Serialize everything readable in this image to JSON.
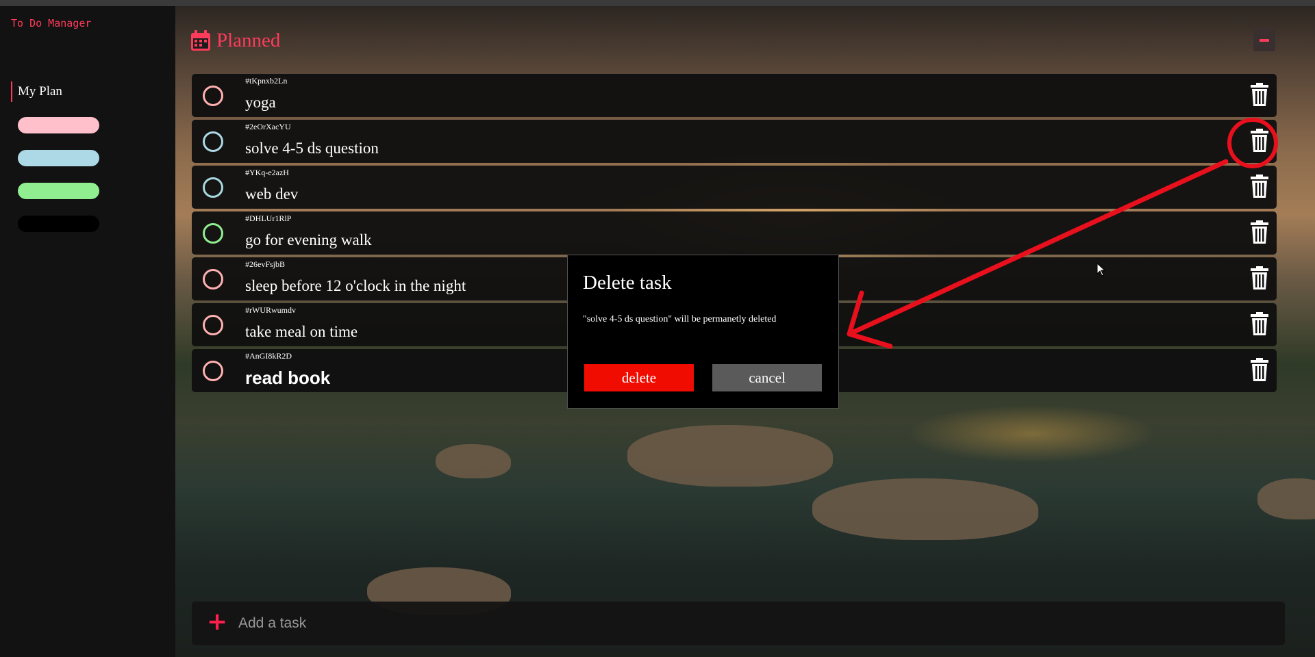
{
  "app": {
    "title": "To Do Manager"
  },
  "sidebar": {
    "my_plan_label": "My Plan",
    "pills": [
      {
        "color": "#ffc0cb",
        "icon": "pink-pill"
      },
      {
        "color": "#add8e6",
        "icon": "blue-pill"
      },
      {
        "color": "#90ee90",
        "icon": "green-pill"
      },
      {
        "color": "#000000",
        "icon": "black-pill"
      }
    ]
  },
  "header": {
    "title": "Planned",
    "icon": "calendar-icon",
    "accent": "#ff3b5c"
  },
  "tasks": [
    {
      "id": "#tKpnxb2Ln",
      "label": "yoga",
      "circle_color": "#ffb0b0"
    },
    {
      "id": "#2eOrXacYU",
      "label": "solve 4-5 ds question",
      "circle_color": "#add8e6"
    },
    {
      "id": "#YKq-e2azH",
      "label": "web dev",
      "circle_color": "#a8d8e0"
    },
    {
      "id": "#DHLUr1RlP",
      "label": "go for evening walk",
      "circle_color": "#90ee90"
    },
    {
      "id": "#26evFsjbB",
      "label": "sleep before 12 o'clock in the night",
      "circle_color": "#ffb0b0"
    },
    {
      "id": "#rWURwumdv",
      "label": "take meal on time",
      "circle_color": "#ffb0b0"
    },
    {
      "id": "#AnGI8kR2D",
      "label": "read book",
      "circle_color": "#ffb0b0"
    }
  ],
  "dialog": {
    "title": "Delete task",
    "message": "\"solve 4-5 ds question\" will be permanetly deleted",
    "delete_label": "delete",
    "cancel_label": "cancel"
  },
  "add_task": {
    "placeholder": "Add a task",
    "plus": "+"
  },
  "colors": {
    "accent": "#ff3b5c",
    "danger": "#f00c00",
    "annotation": "#e8101c"
  }
}
